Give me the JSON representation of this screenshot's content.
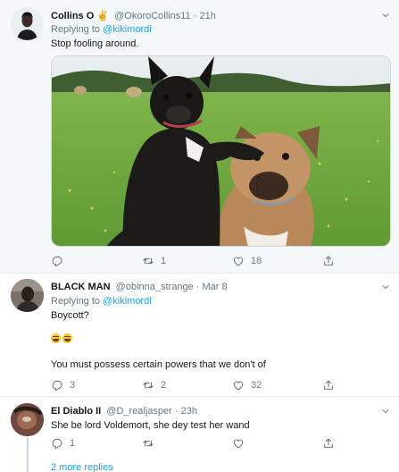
{
  "colors": {
    "link": "#1da1f2",
    "muted": "#657786",
    "text": "#14171a"
  },
  "tweets": [
    {
      "name": "Collins O",
      "name_emoji": "✌",
      "handle": "@OkoroCollins11",
      "time": "· 21h",
      "reply_prefix": "Replying to",
      "reply_handle": "@kikimordi",
      "text": "Stop fooling around.",
      "media_icon": "french-bulldogs-photo",
      "counts": {
        "reply": "",
        "retweet": "1",
        "like": "18"
      }
    },
    {
      "name": "BLACK MAN",
      "handle": "@obinna_strange",
      "time": "· Mar 8",
      "reply_prefix": "Replying to",
      "reply_handle": "@kikimordi",
      "text": "Boycott?",
      "emoji_icon": "joy-emoji",
      "text2": "You must possess certain powers that we don't of",
      "counts": {
        "reply": "3",
        "retweet": "2",
        "like": "32"
      }
    },
    {
      "name": "El Diablo II",
      "handle": "@D_realjasper",
      "time": "· 23h",
      "text": "She be lord Voldemort, she dey test her wand",
      "counts": {
        "reply": "1",
        "retweet": "",
        "like": ""
      }
    }
  ],
  "more_replies": "2 more replies"
}
